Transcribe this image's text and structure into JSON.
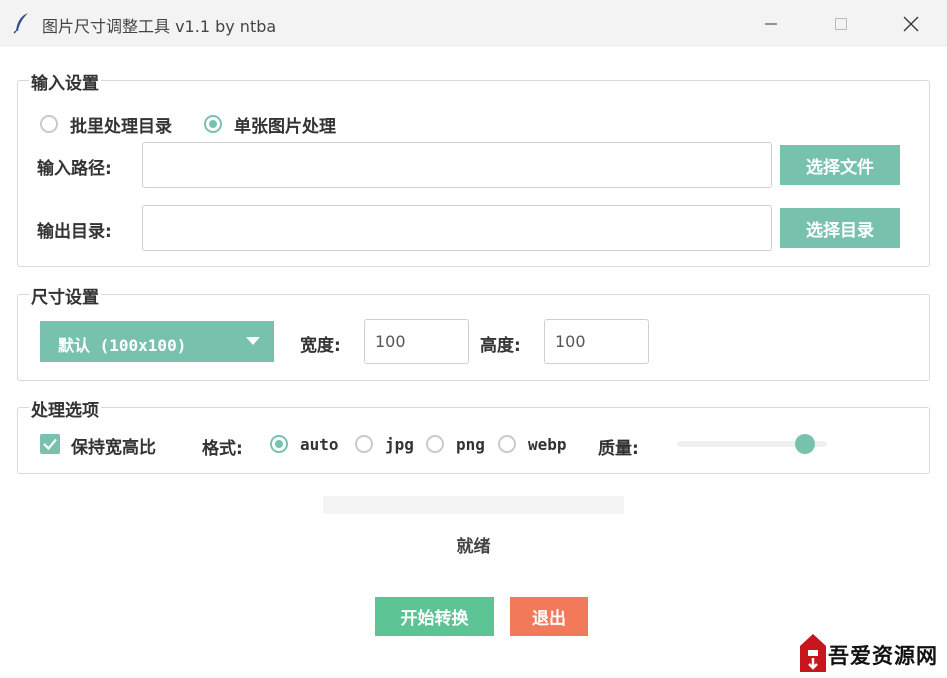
{
  "window": {
    "title": "图片尺寸调整工具 v1.1 by ntba"
  },
  "input_group": {
    "title": "输入设置",
    "mode_options": [
      {
        "label": "批里处理目录",
        "selected": false
      },
      {
        "label": "单张图片处理",
        "selected": true
      }
    ],
    "input_path_label": "输入路径:",
    "input_path_value": "",
    "select_file_label": "选择文件",
    "output_dir_label": "输出目录:",
    "output_dir_value": "",
    "select_dir_label": "选择目录"
  },
  "size_group": {
    "title": "尺寸设置",
    "preset_selected": "默认 (100x100)",
    "width_label": "宽度:",
    "width_value": "100",
    "height_label": "高度:",
    "height_value": "100"
  },
  "options_group": {
    "title": "处理选项",
    "keep_ratio_label": "保持宽高比",
    "keep_ratio_checked": true,
    "format_label": "格式:",
    "formats": [
      {
        "label": "auto",
        "selected": true
      },
      {
        "label": "jpg",
        "selected": false
      },
      {
        "label": "png",
        "selected": false
      },
      {
        "label": "webp",
        "selected": false
      }
    ],
    "quality_label": "质量:",
    "quality_level": 0.85
  },
  "progress": {
    "value": 0
  },
  "status": "就绪",
  "actions": {
    "start_label": "开始转换",
    "exit_label": "退出"
  },
  "colors": {
    "accent": "#78c2ad",
    "start": "#5cc494",
    "exit": "#f3795b"
  },
  "watermark": {
    "text": "吾爱资源网"
  }
}
